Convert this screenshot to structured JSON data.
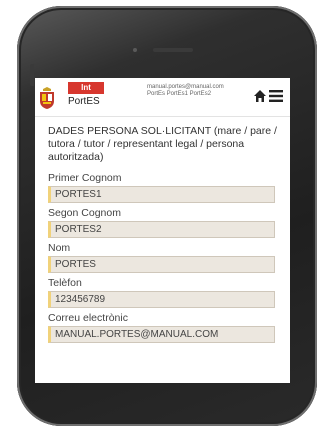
{
  "header": {
    "badge": "Int",
    "app_name": "PortES",
    "user_email": "manual.portes@manual.com",
    "user_names": "PortEs PortEs1 PortEs2"
  },
  "icons": {
    "logo": "coat-of-arms-logo",
    "home": "home-icon",
    "menu": "hamburger-menu-icon"
  },
  "colors": {
    "badge": "#d7372e",
    "input_bg": "#ece7df",
    "input_accent": "#f1d27a"
  },
  "form": {
    "title": "DADES PERSONA SOL·LICITANT (mare / pare / tutora / tutor / representant legal / persona autoritzada)",
    "fields": [
      {
        "label": "Primer Cognom",
        "value": "PORTES1"
      },
      {
        "label": "Segon Cognom",
        "value": "PORTES2"
      },
      {
        "label": "Nom",
        "value": "PORTES"
      },
      {
        "label": "Telèfon",
        "value": "123456789"
      },
      {
        "label": "Correu electrònic",
        "value": "MANUAL.PORTES@MANUAL.COM"
      }
    ]
  }
}
